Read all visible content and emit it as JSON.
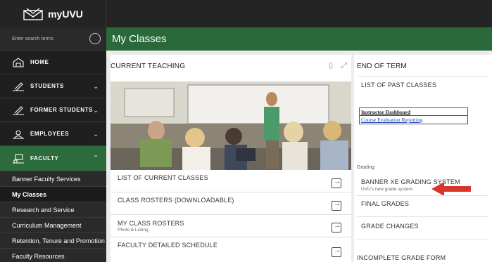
{
  "topbar": {
    "logo_text": "myUVU"
  },
  "sidebar": {
    "search_placeholder": "Enter search terms",
    "items": [
      {
        "label": "HOME"
      },
      {
        "label": "STUDENTS"
      },
      {
        "label": "FORMER STUDENTS"
      },
      {
        "label": "EMPLOYEES"
      },
      {
        "label": "FACULTY"
      }
    ],
    "sub_items": [
      {
        "label": "Banner Faculty Services"
      },
      {
        "label": "My Classes"
      },
      {
        "label": "Research and Service"
      },
      {
        "label": "Curriculum Management"
      },
      {
        "label": "Retention, Tenure and Promotion"
      },
      {
        "label": "Faculty Resources"
      }
    ]
  },
  "header": {
    "title": "My Classes"
  },
  "current_teaching": {
    "title": "CURRENT TEACHING",
    "rows": [
      {
        "label": "LIST OF CURRENT CLASSES"
      },
      {
        "label": "CLASS ROSTERS (DOWNLOADABLE)"
      },
      {
        "label": "MY CLASS ROSTERS",
        "sub": "Photo & Listing"
      },
      {
        "label": "FACULTY DETAILED SCHEDULE"
      }
    ]
  },
  "end_of_term": {
    "title": "END OF TERM",
    "past_classes": "LIST OF PAST CLASSES",
    "dashboard_title": "Instructor Dashboard",
    "dashboard_link": "Course Evaluation Reporting",
    "grading_label": "Grading",
    "banner_xe": "BANNER XE GRADING SYSTEM",
    "banner_xe_sub": "UVU's new grade system.",
    "final_grades": "FINAL GRADES",
    "grade_changes": "GRADE CHANGES",
    "incomplete": "INCOMPLETE GRADE FORM"
  },
  "colors": {
    "brand_green": "#2a6a3a",
    "arrow_red": "#d9372c"
  }
}
